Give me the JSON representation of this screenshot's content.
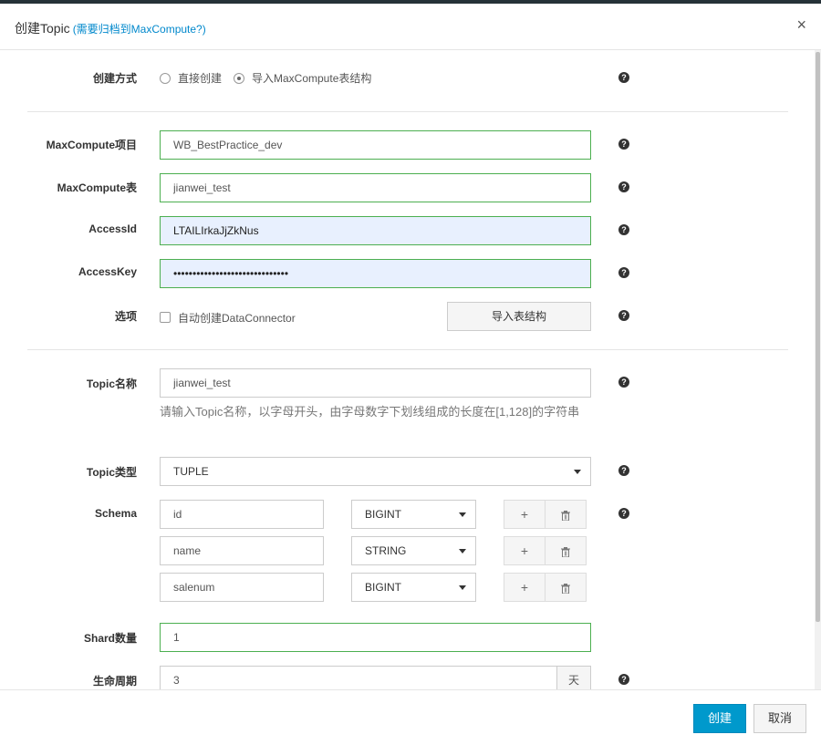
{
  "header": {
    "title": "创建Topic",
    "archive_link": "(需要归档到MaxCompute?)",
    "close_glyph": "×"
  },
  "create_mode": {
    "label": "创建方式",
    "options": [
      "直接创建",
      "导入MaxCompute表结构"
    ],
    "selected": "导入MaxCompute表结构"
  },
  "maxcompute": {
    "project_label": "MaxCompute项目",
    "project_value": "WB_BestPractice_dev",
    "table_label": "MaxCompute表",
    "table_value": "jianwei_test",
    "access_id_label": "AccessId",
    "access_id_value": "LTAILIrkaJjZkNus",
    "access_key_label": "AccessKey",
    "access_key_value": "••••••••••••••••••••••••••••••",
    "options_label": "选项",
    "auto_connector_label": "自动创建DataConnector",
    "auto_connector_checked": false,
    "import_button": "导入表结构"
  },
  "topic": {
    "name_label": "Topic名称",
    "name_value": "jianwei_test",
    "name_hint": "请输入Topic名称，以字母开头，由字母数字下划线组成的长度在[1,128]的字符串",
    "type_label": "Topic类型",
    "type_value": "TUPLE",
    "schema_label": "Schema",
    "schema": [
      {
        "field": "id",
        "type": "BIGINT"
      },
      {
        "field": "name",
        "type": "STRING"
      },
      {
        "field": "salenum",
        "type": "BIGINT"
      }
    ],
    "shard_label": "Shard数量",
    "shard_value": "1",
    "lifecycle_label": "生命周期",
    "lifecycle_value": "3",
    "lifecycle_unit": "天"
  },
  "help_glyph": "?",
  "add_glyph": "+",
  "footer": {
    "create_button": "创建",
    "cancel_button": "取消"
  },
  "colors": {
    "primary": "#0099cc",
    "valid_border": "#4caf50",
    "autofill_bg": "#e8f0fe",
    "link": "#0088cc"
  }
}
